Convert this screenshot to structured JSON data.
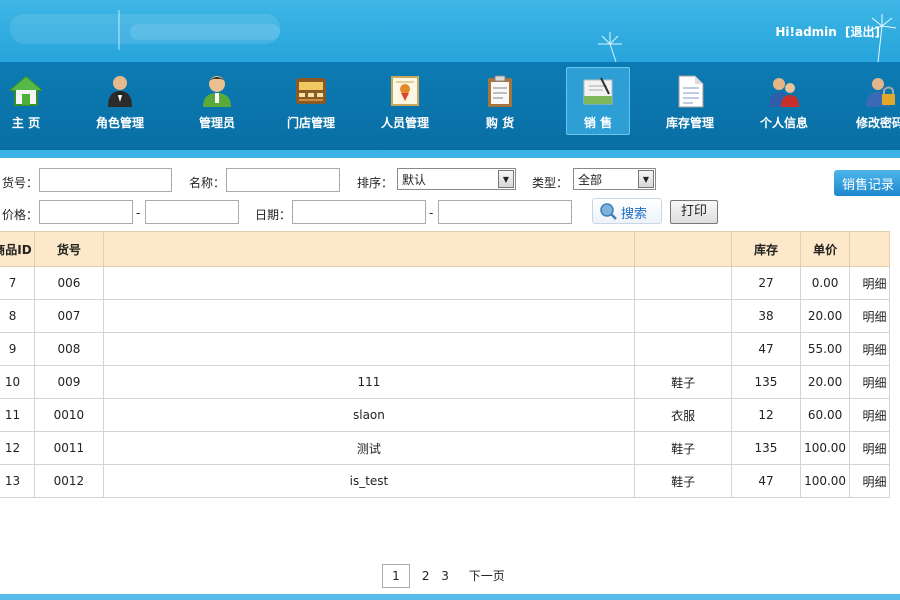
{
  "header": {
    "greeting": "Hi!",
    "username": "admin",
    "logout": "[退出]"
  },
  "nav": [
    {
      "label": "主  页",
      "icon": "home-icon"
    },
    {
      "label": "角色管理",
      "icon": "waiter-role-icon"
    },
    {
      "label": "管理员",
      "icon": "admin-user-icon"
    },
    {
      "label": "门店管理",
      "icon": "store-register-icon"
    },
    {
      "label": "人员管理",
      "icon": "staff-certificate-icon"
    },
    {
      "label": "购  货",
      "icon": "purchase-clipboard-icon"
    },
    {
      "label": "销  售",
      "icon": "sales-ledger-icon"
    },
    {
      "label": "库存管理",
      "icon": "inventory-document-icon"
    },
    {
      "label": "个人信息",
      "icon": "personal-info-users-icon"
    },
    {
      "label": "修改密码",
      "icon": "password-lock-user-icon"
    }
  ],
  "filters": {
    "goods_no_label": "货号：",
    "goods_no_value": "",
    "name_label": "名称：",
    "name_value": "",
    "sort_label": "排序：",
    "sort_value": "默认",
    "type_label": "类型：",
    "type_value": "全部",
    "price_label": "价格：",
    "price_from": "",
    "price_to": "",
    "range_dash": "-",
    "date_label": "日期：",
    "date_from": "",
    "date_to": "",
    "search_label": "搜索",
    "print_label": "打印",
    "sales_record_label": "销售记录"
  },
  "table": {
    "headers": [
      "商品ID",
      "货号",
      "",
      "",
      "库存",
      "单价",
      ""
    ],
    "rows": [
      {
        "id": "7",
        "no": "006",
        "name": "",
        "type": "",
        "stock": "27",
        "price": "0.00",
        "detail": "明细"
      },
      {
        "id": "8",
        "no": "007",
        "name": "",
        "type": "",
        "stock": "38",
        "price": "20.00",
        "detail": "明细"
      },
      {
        "id": "9",
        "no": "008",
        "name": "",
        "type": "",
        "stock": "47",
        "price": "55.00",
        "detail": "明细"
      },
      {
        "id": "10",
        "no": "009",
        "name": "111",
        "type": "鞋子",
        "stock": "135",
        "price": "20.00",
        "detail": "明细"
      },
      {
        "id": "11",
        "no": "0010",
        "name": "slaon",
        "type": "衣服",
        "stock": "12",
        "price": "60.00",
        "detail": "明细"
      },
      {
        "id": "12",
        "no": "0011",
        "name": "测试",
        "type": "鞋子",
        "stock": "135",
        "price": "100.00",
        "detail": "明细"
      },
      {
        "id": "13",
        "no": "0012",
        "name": "is_test",
        "type": "鞋子",
        "stock": "47",
        "price": "100.00",
        "detail": "明细"
      }
    ]
  },
  "pager": {
    "pages": [
      "1",
      "2",
      "3"
    ],
    "current": "1",
    "next": "下一页"
  },
  "colors": {
    "header_top": "#2aa6dc",
    "nav_bg": "#0a72a8",
    "table_header_bg": "#fde9c9",
    "link_blue": "#1f6cc5"
  }
}
